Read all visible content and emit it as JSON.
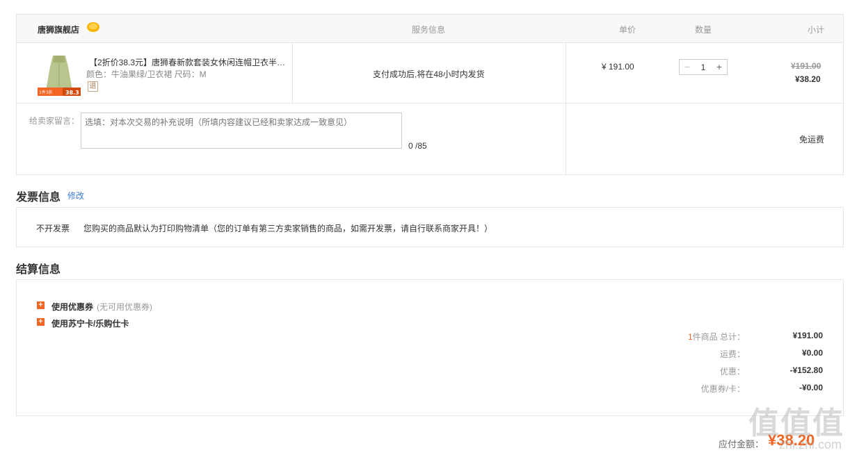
{
  "order": {
    "store_name": "唐狮旗舰店",
    "headers": {
      "service": "服务信息",
      "price": "单价",
      "quantity": "数量",
      "subtotal": "小计"
    },
    "product": {
      "name": "【2折价38.3元】唐狮春新款套装女休闲连帽卫衣半…",
      "spec": "颜色：牛油果绿/卫衣裙   尺码：M",
      "return_badge": "退",
      "thumb_tag_left": "1件3折",
      "thumb_tag_right": "38.3",
      "service": "支付成功后,将在48小时内发货",
      "unit_price": "¥ 191.00",
      "quantity": "1",
      "original_subtotal": "¥191.00",
      "subtotal": "¥38.20"
    },
    "message": {
      "label": "给卖家留言：",
      "placeholder": "选填：对本次交易的补充说明（所填内容建议已经和卖家达成一致意见）",
      "count": "0 /85"
    },
    "shipping": "免运费"
  },
  "invoice": {
    "title": "发票信息",
    "edit_label": "修改",
    "type": "不开发票",
    "description": "您购买的商品默认为打印购物清单（您的订单有第三方卖家销售的商品，如需开发票，请自行联系商家开具！）"
  },
  "settlement": {
    "title": "结算信息",
    "coupon_label": "使用优惠券",
    "coupon_note": "(无可用优惠券)",
    "card_label": "使用苏宁卡/乐购仕卡",
    "summary": {
      "items_count": "1",
      "items_label": "件商品 总计：",
      "total_value": "¥191.00",
      "shipping_label": "运费：",
      "shipping_value": "¥0.00",
      "discount_label": "优惠：",
      "discount_value": "-¥152.80",
      "coupon_label": "优惠券/卡：",
      "coupon_value": "-¥0.00"
    },
    "payable_label": "应付金额：",
    "payable_value": "¥38.20"
  },
  "watermark": {
    "chars": "值值值",
    "site": "zhi.zhi.com"
  },
  "colors": {
    "accent": "#f26522",
    "link": "#3a7bd5",
    "border": "#e6e6e6"
  }
}
